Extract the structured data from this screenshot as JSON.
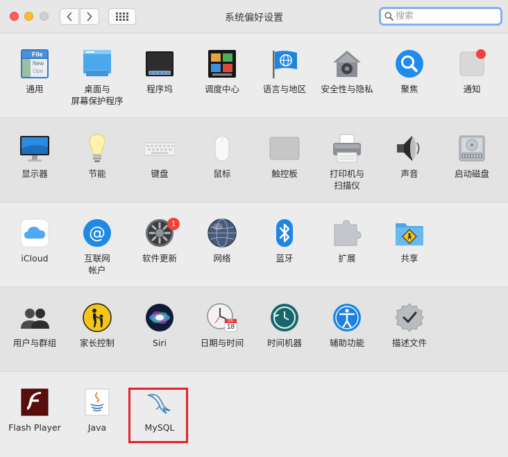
{
  "window": {
    "title": "系统偏好设置",
    "search_placeholder": "搜索"
  },
  "sections": [
    [
      {
        "label": "通用",
        "icon": "general-icon"
      },
      {
        "label": "桌面与\n屏幕保护程序",
        "icon": "desktop-screensaver-icon"
      },
      {
        "label": "程序坞",
        "icon": "dock-icon"
      },
      {
        "label": "调度中心",
        "icon": "mission-control-icon"
      },
      {
        "label": "语言与地区",
        "icon": "language-region-icon"
      },
      {
        "label": "安全性与隐私",
        "icon": "security-privacy-icon"
      },
      {
        "label": "聚焦",
        "icon": "spotlight-icon"
      },
      {
        "label": "通知",
        "icon": "notifications-icon"
      }
    ],
    [
      {
        "label": "显示器",
        "icon": "displays-icon"
      },
      {
        "label": "节能",
        "icon": "energy-saver-icon"
      },
      {
        "label": "键盘",
        "icon": "keyboard-icon"
      },
      {
        "label": "鼠标",
        "icon": "mouse-icon"
      },
      {
        "label": "触控板",
        "icon": "trackpad-icon"
      },
      {
        "label": "打印机与\n扫描仪",
        "icon": "printers-scanners-icon"
      },
      {
        "label": "声音",
        "icon": "sound-icon"
      },
      {
        "label": "启动磁盘",
        "icon": "startup-disk-icon"
      }
    ],
    [
      {
        "label": "iCloud",
        "icon": "icloud-icon"
      },
      {
        "label": "互联网\n帐户",
        "icon": "internet-accounts-icon"
      },
      {
        "label": "软件更新",
        "icon": "software-update-icon",
        "badge": "1"
      },
      {
        "label": "网络",
        "icon": "network-icon"
      },
      {
        "label": "蓝牙",
        "icon": "bluetooth-icon"
      },
      {
        "label": "扩展",
        "icon": "extensions-icon"
      },
      {
        "label": "共享",
        "icon": "sharing-icon"
      }
    ],
    [
      {
        "label": "用户与群组",
        "icon": "users-groups-icon"
      },
      {
        "label": "家长控制",
        "icon": "parental-controls-icon"
      },
      {
        "label": "Siri",
        "icon": "siri-icon"
      },
      {
        "label": "日期与时间",
        "icon": "date-time-icon",
        "date": "18",
        "month": "JUL"
      },
      {
        "label": "时间机器",
        "icon": "time-machine-icon"
      },
      {
        "label": "辅助功能",
        "icon": "accessibility-icon"
      },
      {
        "label": "描述文件",
        "icon": "profiles-icon"
      }
    ],
    [
      {
        "label": "Flash Player",
        "icon": "flash-player-icon"
      },
      {
        "label": "Java",
        "icon": "java-icon"
      },
      {
        "label": "MySQL",
        "icon": "mysql-icon"
      }
    ]
  ],
  "colors": {
    "close": "#fe5f57",
    "minimize": "#febc2e",
    "search_focus": "#7fb1ef",
    "highlight_box": "#e8202b"
  }
}
